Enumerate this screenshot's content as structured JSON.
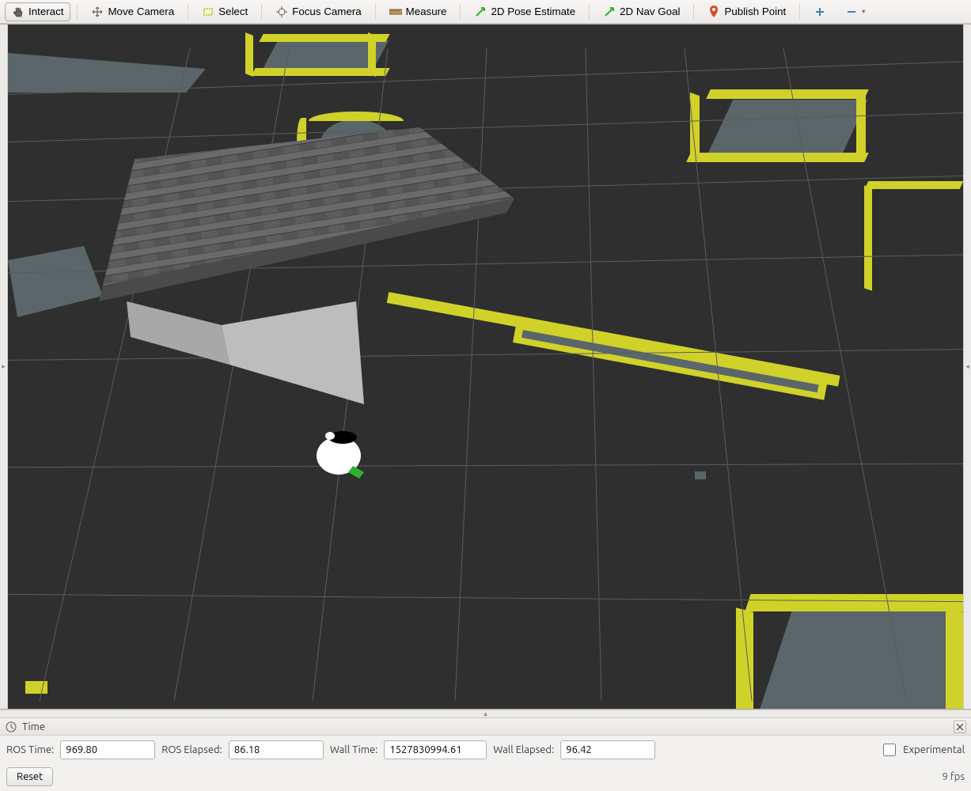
{
  "toolbar": {
    "interact": "Interact",
    "move_camera": "Move Camera",
    "select": "Select",
    "focus_camera": "Focus Camera",
    "measure": "Measure",
    "pose_estimate": "2D Pose Estimate",
    "nav_goal": "2D Nav Goal",
    "publish_point": "Publish Point"
  },
  "time": {
    "panel_title": "Time",
    "ros_time_label": "ROS Time:",
    "ros_time_value": "969.80",
    "ros_elapsed_label": "ROS Elapsed:",
    "ros_elapsed_value": "86.18",
    "wall_time_label": "Wall Time:",
    "wall_time_value": "1527830994.61",
    "wall_elapsed_label": "Wall Elapsed:",
    "wall_elapsed_value": "96.42",
    "experimental_label": "Experimental",
    "reset_label": "Reset",
    "fps": "9 fps"
  },
  "icons": {
    "interact": "hand-icon",
    "move_camera": "move-camera-icon",
    "select": "select-rect-icon",
    "focus_camera": "crosshair-icon",
    "measure": "ruler-icon",
    "pose_arrow": "green-arrow-icon",
    "publish_pin": "pin-icon",
    "plus": "plus-icon",
    "minus": "minus-icon",
    "clock": "clock-icon"
  },
  "scene": {
    "background": "#2f2f2f",
    "grid_color": "#5c5c5c",
    "obstacle_color": "#d0d22a",
    "map_free_color": "#5a6669",
    "robot_body_color": "#ffffff",
    "robot_sensor_color": "#000000",
    "robot_beam_color": "#2cb22c"
  }
}
